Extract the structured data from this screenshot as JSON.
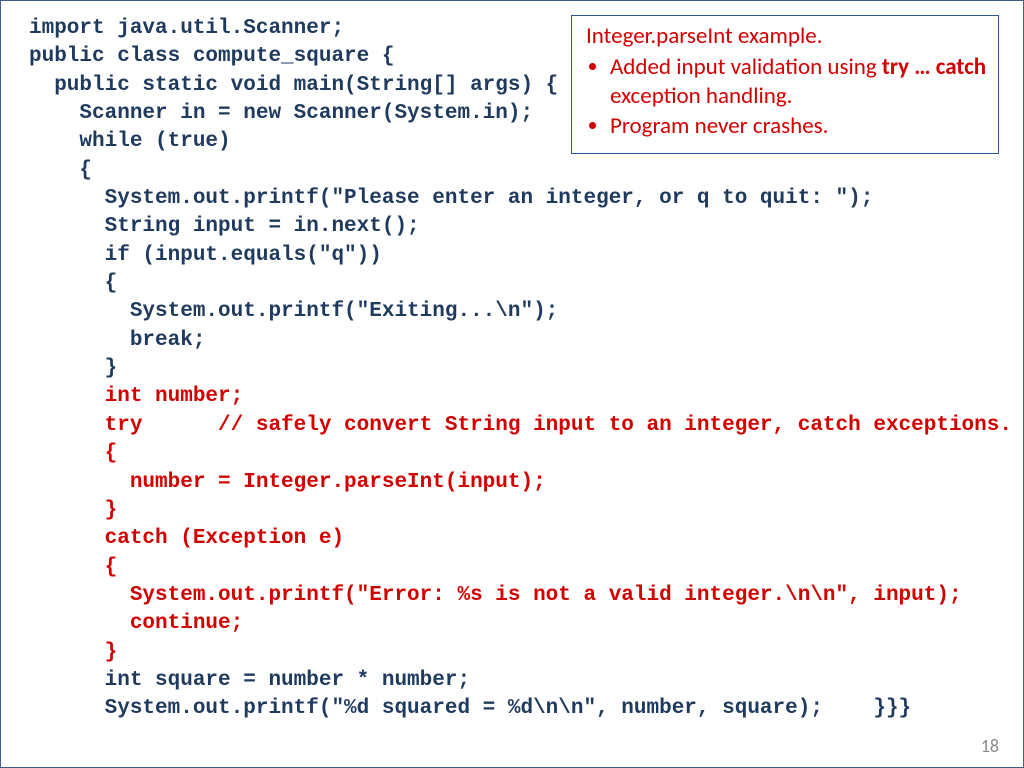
{
  "annotation": {
    "title": "Integer.parseInt example.",
    "b1_a": "Added input validation using ",
    "b1_b": "try … catch",
    "b1_c": " exception handling.",
    "b2": "Program never crashes."
  },
  "code": {
    "l01": "import java.util.Scanner;",
    "l02": "public class compute_square {",
    "l03": "  public static void main(String[] args) {",
    "l04": "    Scanner in = new Scanner(System.in);",
    "l05": "    while (true)",
    "l06": "    {",
    "l07": "      System.out.printf(\"Please enter an integer, or q to quit: \");",
    "l08": "      String input = in.next();",
    "l09": "      if (input.equals(\"q\"))",
    "l10": "      {",
    "l11": "        System.out.printf(\"Exiting...\\n\");",
    "l12": "        break;",
    "l13": "      }",
    "l14": "      int number;",
    "l15": "      try      // safely convert String input to an integer, catch exceptions.",
    "l16": "      {",
    "l17": "        number = Integer.parseInt(input);",
    "l18": "      }",
    "l19": "      catch (Exception e)",
    "l20": "      {",
    "l21": "        System.out.printf(\"Error: %s is not a valid integer.\\n\\n\", input);",
    "l22": "        continue;",
    "l23": "      }",
    "l24": "      int square = number * number;",
    "l25a": "      System.out.printf(\"%d squared = %d\\n\\n\", number, square);",
    "l25b": "    }}}"
  },
  "page_number": "18"
}
